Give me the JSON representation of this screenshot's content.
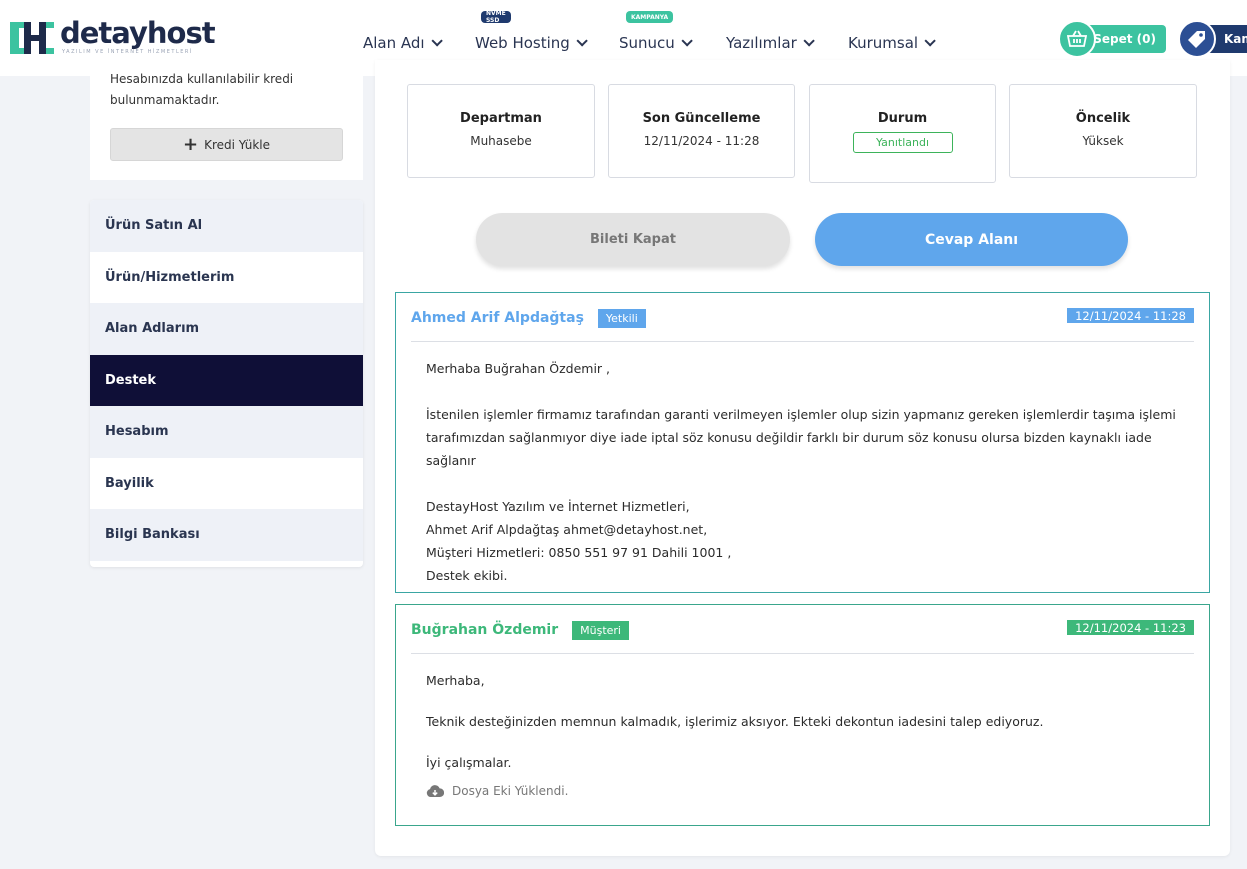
{
  "brand": {
    "name": "detayhost",
    "tagline": "YAZILIM VE İNTERNET HİZMETLERİ",
    "colors": {
      "teal": "#3cc3a0",
      "navy": "#1e2a4a",
      "blue": "#5fa6ec",
      "green": "#3db87a",
      "active": "#0f0f37"
    }
  },
  "nav": {
    "items": [
      {
        "label": "Alan Adı",
        "badge": ""
      },
      {
        "label": "Web Hosting",
        "badge": "NVME SSD"
      },
      {
        "label": "Sunucu",
        "badge": "KAMPANYA"
      },
      {
        "label": "Yazılımlar",
        "badge": ""
      },
      {
        "label": "Kurumsal",
        "badge": ""
      }
    ],
    "cart_label": "Sepet (0)",
    "campaign_label": "Kam"
  },
  "sidebar": {
    "credit_note": "Hesabınızda kullanılabilir kredi bulunmamaktadır.",
    "credit_button": "Kredi Yükle",
    "menu": [
      {
        "label": "Ürün Satın Al"
      },
      {
        "label": "Ürün/Hizmetlerim"
      },
      {
        "label": "Alan Adlarım"
      },
      {
        "label": "Destek",
        "active": true
      },
      {
        "label": "Hesabım"
      },
      {
        "label": "Bayilik"
      },
      {
        "label": "Bilgi Bankası"
      }
    ]
  },
  "ticket": {
    "department": {
      "label": "Departman",
      "value": "Muhasebe"
    },
    "updated": {
      "label": "Son Güncelleme",
      "value": "12/11/2024 - 11:28"
    },
    "status": {
      "label": "Durum",
      "value": "Yanıtlandı"
    },
    "priority": {
      "label": "Öncelik",
      "value": "Yüksek"
    },
    "close_button": "Bileti Kapat",
    "reply_button": "Cevap Alanı"
  },
  "messages": [
    {
      "author": "Ahmed Arif Alpdağtaş",
      "role": "Yetkili",
      "date": "12/11/2024 - 11:28",
      "greeting": "Merhaba Buğrahan Özdemir ,",
      "line1": "İstenilen işlemler firmamız tarafından garanti verilmeyen işlemler olup sizin yapmanız gereken işlemlerdir taşıma işlemi",
      "line2": "tarafımızdan sağlanmıyor diye iade iptal söz konusu değildir farklı bir durum söz konusu olursa bizden kaynaklı iade sağlanır",
      "sig1": "DestayHost Yazılım ve İnternet Hizmetleri,",
      "sig2": "Ahmet Arif Alpdağtaş ahmet@detayhost.net,",
      "sig3": "Müşteri Hizmetleri: 0850 551 97 91 Dahili 1001 ,",
      "sig4": "Destek ekibi."
    },
    {
      "author": "Buğrahan Özdemir",
      "role": "Müşteri",
      "date": "12/11/2024 - 11:23",
      "greeting": "Merhaba,",
      "line1": "Teknik desteğinizden memnun kalmadık, işlerimiz aksıyor. Ekteki dekontun iadesini talep ediyoruz.",
      "closing": "İyi çalışmalar.",
      "attachment": "Dosya Eki Yüklendi."
    }
  ]
}
